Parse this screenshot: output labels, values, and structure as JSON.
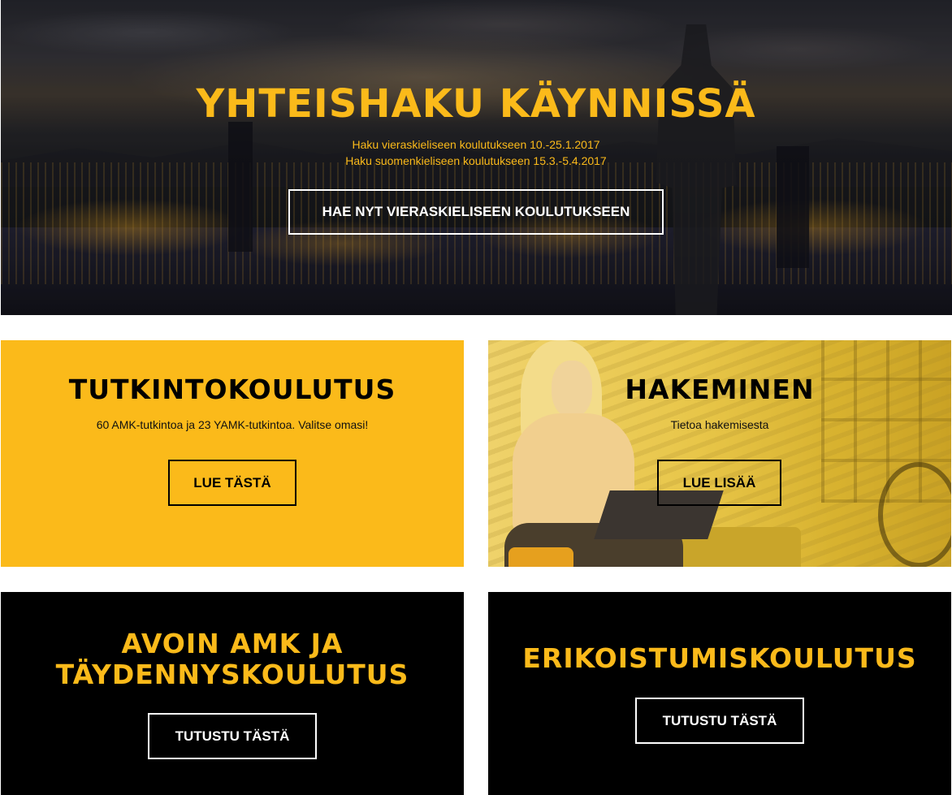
{
  "hero": {
    "title": "YHTEISHAKU KÄYNNISSÄ",
    "line1": "Haku vieraskieliseen koulutukseen 10.-25.1.2017",
    "line2": "Haku suomenkieliseen koulutukseen 15.3.-5.4.2017",
    "button_label": "HAE NYT VIERASKIELISEEN KOULUTUKSEEN"
  },
  "cards": [
    {
      "title": "TUTKINTOKOULUTUS",
      "subtitle": "60 AMK-tutkintoa ja 23 YAMK-tutkintoa. Valitse omasi!",
      "button_label": "LUE TÄSTÄ"
    },
    {
      "title": "HAKEMINEN",
      "subtitle": "Tietoa hakemisesta",
      "button_label": "LUE LISÄÄ"
    },
    {
      "title_line1": "AVOIN AMK JA",
      "title_line2": "TÄYDENNYSKOULUTUS",
      "button_label": "TUTUSTU TÄSTÄ"
    },
    {
      "title": "ERIKOISTUMISKOULUTUS",
      "button_label": "TUTUSTU TÄSTÄ"
    }
  ],
  "colors": {
    "accent_yellow": "#fbba1a",
    "black": "#000000",
    "white": "#ffffff"
  }
}
